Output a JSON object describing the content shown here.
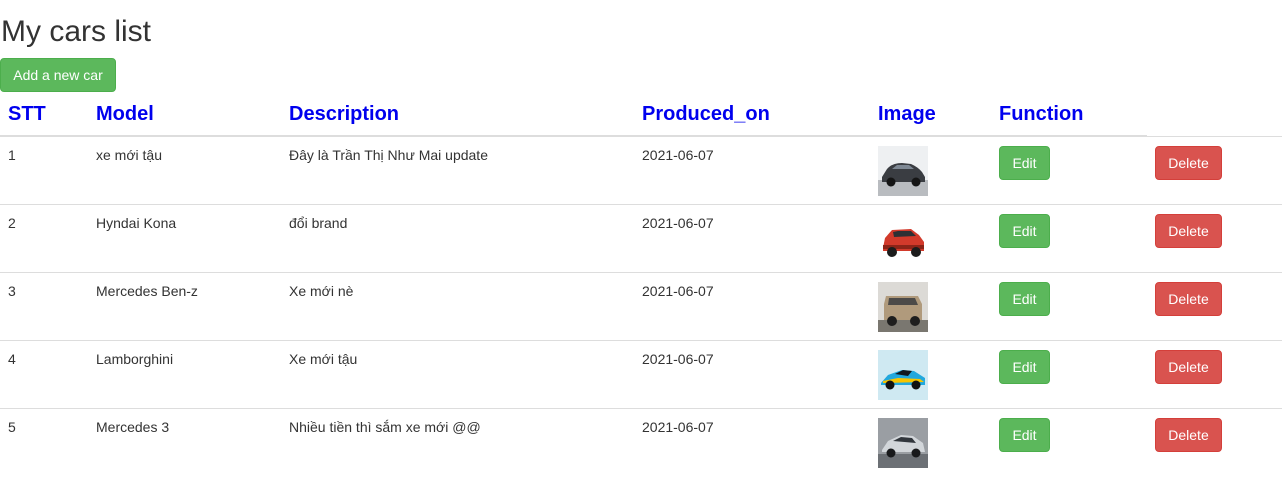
{
  "title": "My cars list",
  "add_button_label": "Add a new car",
  "headers": {
    "stt": "STT",
    "model": "Model",
    "description": "Description",
    "produced_on": "Produced_on",
    "image": "Image",
    "function": "Function"
  },
  "buttons": {
    "edit": "Edit",
    "delete": "Delete"
  },
  "colors": {
    "header_text": "#0000ee",
    "success": "#5cb85c",
    "danger": "#d9534f"
  },
  "rows": [
    {
      "stt": "1",
      "model": "xe mới tậu",
      "description": "Đây là Trần Thị Như Mai update",
      "produced_on": "2021-06-07",
      "image": "dark-grey-sedan-thumbnail"
    },
    {
      "stt": "2",
      "model": "Hyndai Kona",
      "description": "đổi brand",
      "produced_on": "2021-06-07",
      "image": "red-suv-thumbnail"
    },
    {
      "stt": "3",
      "model": "Mercedes Ben-z",
      "description": "Xe mới nè",
      "produced_on": "2021-06-07",
      "image": "beige-offroad-truck-thumbnail"
    },
    {
      "stt": "4",
      "model": "Lamborghini",
      "description": "Xe mới tậu",
      "produced_on": "2021-06-07",
      "image": "blue-sports-car-thumbnail"
    },
    {
      "stt": "5",
      "model": "Mercedes 3",
      "description": "Nhiều tiền thì sắm xe mới @@",
      "produced_on": "2021-06-07",
      "image": "silver-coupe-thumbnail"
    }
  ]
}
